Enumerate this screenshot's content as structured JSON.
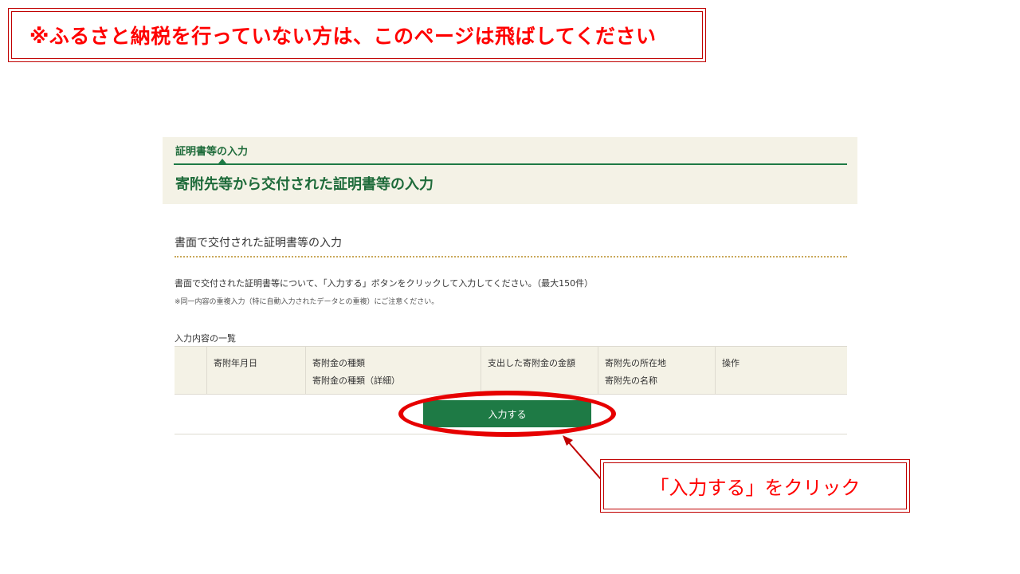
{
  "annotations": {
    "top_note": "※ふるさと納税を行っていない方は、このページは飛ばしてください",
    "callout": "「入力する」をクリック",
    "accent_color": "#ff0000"
  },
  "header": {
    "breadcrumb": "証明書等の入力",
    "title": "寄附先等から交付された証明書等の入力"
  },
  "section": {
    "heading": "書面で交付された証明書等の入力",
    "description": "書面で交付された証明書等について、「入力する」ボタンをクリックして入力してください。（最大150件）",
    "note": "※同一内容の重複入力（特に自動入力されたデータとの重複）にご注意ください。",
    "list_caption": "入力内容の一覧"
  },
  "table": {
    "headers": [
      {
        "line1": "",
        "line2": ""
      },
      {
        "line1": "寄附年月日",
        "line2": ""
      },
      {
        "line1": "寄附金の種類",
        "line2": "寄附金の種類（詳細）"
      },
      {
        "line1": "支出した寄附金の金額",
        "line2": ""
      },
      {
        "line1": "寄附先の所在地",
        "line2": "寄附先の名称"
      },
      {
        "line1": "操作",
        "line2": ""
      }
    ]
  },
  "button": {
    "label": "入力する",
    "color": "#1e7a45"
  }
}
